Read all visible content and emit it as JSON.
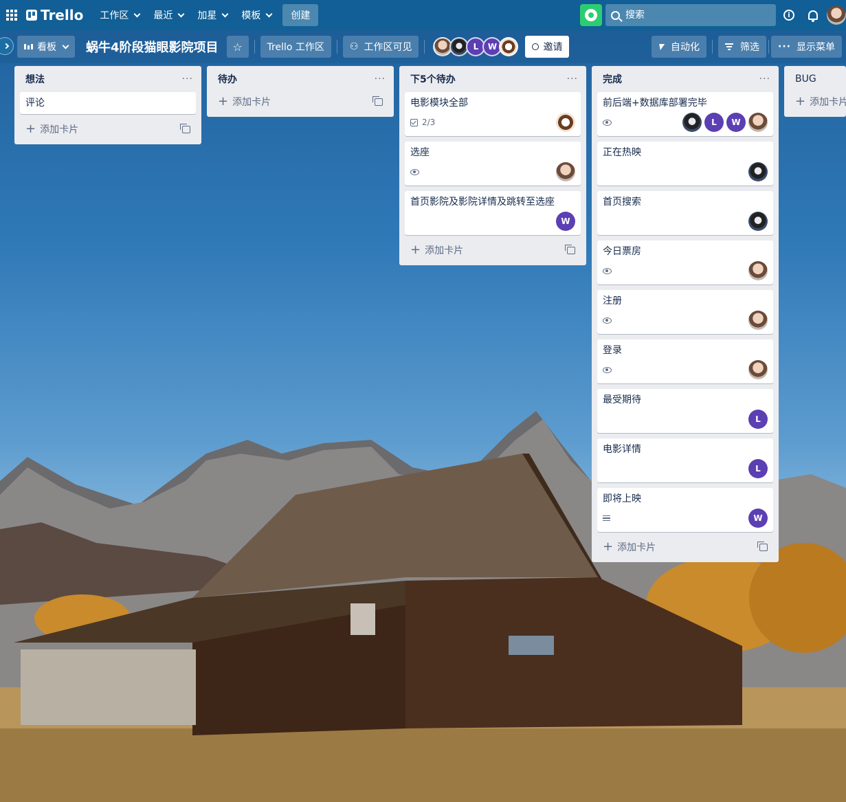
{
  "topnav": {
    "brand": "Trello",
    "menu": [
      {
        "label": "工作区"
      },
      {
        "label": "最近"
      },
      {
        "label": "加星"
      },
      {
        "label": "模板"
      }
    ],
    "create_label": "创建",
    "search_placeholder": "搜索"
  },
  "board": {
    "view_label": "看板",
    "title": "蜗牛4阶段猫眼影院项目",
    "workspace_label": "Trello 工作区",
    "visibility_label": "工作区可见",
    "members": [
      {
        "initial": "",
        "style": "photo1"
      },
      {
        "initial": "",
        "style": "photo2"
      },
      {
        "initial": "L",
        "style": "purple"
      },
      {
        "initial": "W",
        "style": "purple"
      },
      {
        "initial": "",
        "style": "photo3"
      }
    ],
    "invite_label": "邀请",
    "automation_label": "自动化",
    "filter_label": "筛选",
    "menu_label": "显示菜单"
  },
  "lists": [
    {
      "title": "想法",
      "cards": [
        {
          "title": "评论"
        }
      ],
      "add_label": "添加卡片"
    },
    {
      "title": "待办",
      "cards": [],
      "add_label": "添加卡片"
    },
    {
      "title": "下5个待办",
      "cards": [
        {
          "title": "电影模块全部",
          "checklist": "2/3"
        },
        {
          "title": "选座"
        },
        {
          "title": "首页影院及影院详情及跳转至选座"
        }
      ],
      "add_label": "添加卡片"
    },
    {
      "title": "完成",
      "cards": [
        {
          "title": "前后端+数据库部署完毕"
        },
        {
          "title": "正在热映"
        },
        {
          "title": "首页搜索"
        },
        {
          "title": "今日票房"
        },
        {
          "title": "注册"
        },
        {
          "title": "登录"
        },
        {
          "title": "最受期待"
        },
        {
          "title": "电影详情"
        },
        {
          "title": "即将上映"
        }
      ],
      "add_label": "添加卡片"
    },
    {
      "title": "BUG",
      "cards": [],
      "add_label": "添加卡片"
    }
  ],
  "colors": {
    "nav_bg": "#106096",
    "list_bg": "#ebecf0",
    "avatar_purple": "#5b3fb3",
    "green_button": "#2ecc71"
  }
}
